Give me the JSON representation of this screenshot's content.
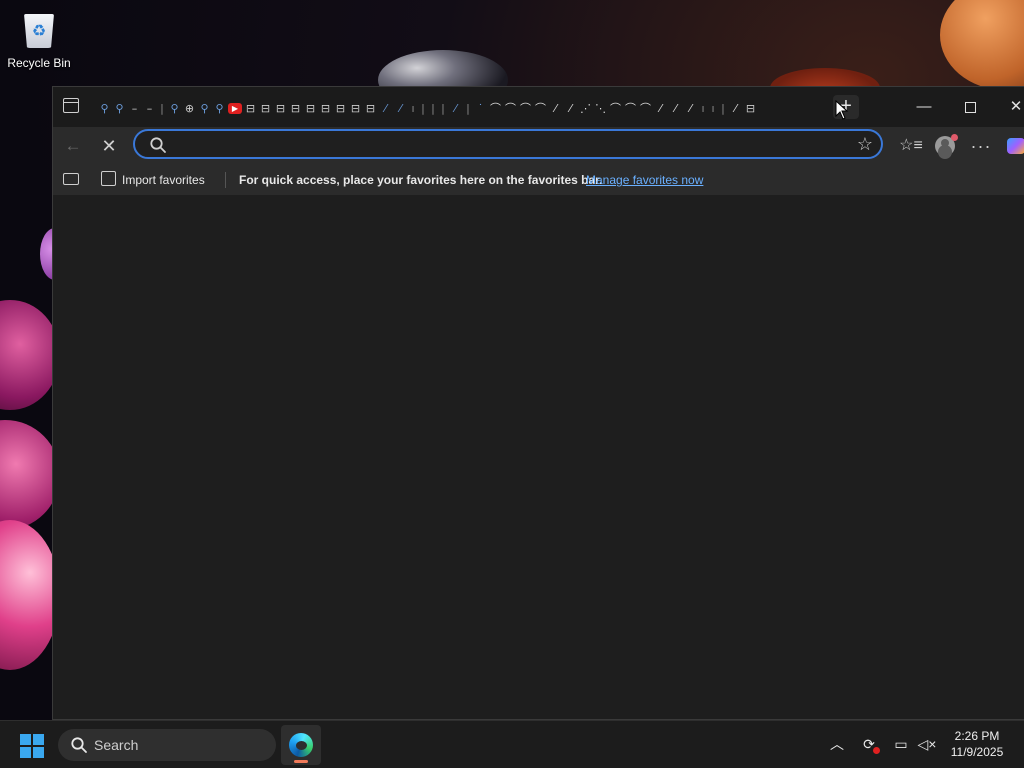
{
  "desktop": {
    "recycle_bin_label": "Recycle Bin"
  },
  "browser": {
    "titlebar": {
      "tab_count_note": "many favicon-only tabs",
      "new_tab_symbol": "+",
      "minimize_symbol": "—",
      "close_symbol": "✕"
    },
    "toolbar": {
      "back_icon": "back-arrow-icon",
      "stop_symbol": "✕",
      "address_value": "",
      "address_placeholder": "",
      "more_symbol": "···"
    },
    "favorites_bar": {
      "import_label": "Import favorites",
      "message": "For quick access, place your favorites here on the favorites bar.",
      "manage_link": "Manage favorites now"
    }
  },
  "taskbar": {
    "search_label": "Search",
    "time": "2:26 PM",
    "date": "11/9/2025"
  },
  "colors": {
    "accent": "#3a78d8",
    "link": "#6ab0ff",
    "window_bg": "#1e1e1e",
    "toolbar_bg": "#2b2b2b"
  }
}
